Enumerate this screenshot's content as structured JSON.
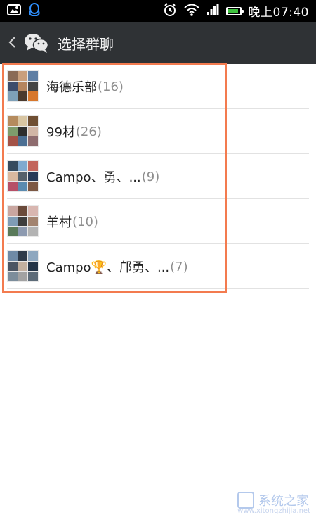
{
  "status_bar": {
    "time": "晚上07:40",
    "battery_level": 0.85,
    "icons": [
      "image-icon",
      "qq-icon",
      "alarm-icon",
      "wifi-icon",
      "signal-icon",
      "battery-icon"
    ]
  },
  "header": {
    "back_icon": "chevron-left-icon",
    "app_icon": "wechat-icon",
    "title": "选择群聊"
  },
  "groups": [
    {
      "name": "海德乐部",
      "count": "(16)"
    },
    {
      "name": "99材",
      "count": "(26)"
    },
    {
      "name": "Campo、勇、...",
      "count": "(9)"
    },
    {
      "name": "羊村",
      "count": "(10)"
    },
    {
      "name": "Campo🏆、邝勇、...",
      "count": "(7)"
    }
  ],
  "colors": {
    "titlebar": "#2f3235",
    "highlight": "#f37b4f",
    "divider": "#e2e2e2"
  },
  "watermark": {
    "brand": "系统之家",
    "url": "www.xitongzhijia.net"
  }
}
